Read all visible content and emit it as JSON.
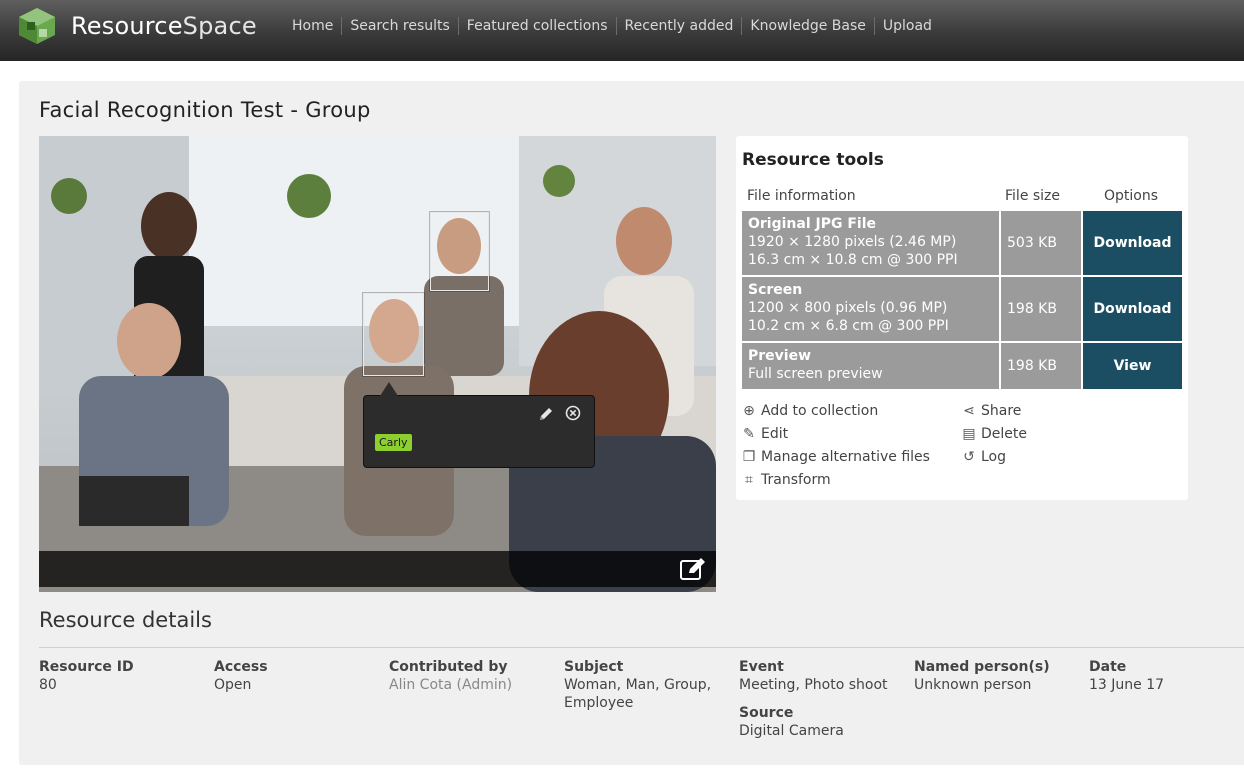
{
  "app": {
    "name_bold": "Resource",
    "name_light": "Space"
  },
  "nav": [
    "Home",
    "Search results",
    "Featured collections",
    "Recently added",
    "Knowledge Base",
    "Upload"
  ],
  "page": {
    "title": "Facial Recognition Test - Group"
  },
  "preview": {
    "tag_label": "Carly"
  },
  "tools": {
    "title": "Resource tools",
    "headers": {
      "info": "File information",
      "size": "File size",
      "options": "Options"
    },
    "files": [
      {
        "name": "Original JPG File",
        "line1": "1920 × 1280 pixels (2.46 MP)",
        "line2": "16.3 cm × 10.8 cm @ 300 PPI",
        "size": "503 KB",
        "action": "Download"
      },
      {
        "name": "Screen",
        "line1": "1200 × 800 pixels (0.96 MP)",
        "line2": "10.2 cm × 6.8 cm @ 300 PPI",
        "size": "198 KB",
        "action": "Download"
      },
      {
        "name": "Preview",
        "line1": "Full screen preview",
        "line2": "",
        "size": "198 KB",
        "action": "View"
      }
    ],
    "actions": {
      "add_to_collection": "Add to collection",
      "share": "Share",
      "edit": "Edit",
      "delete": "Delete",
      "manage_alternative": "Manage alternative files",
      "log": "Log",
      "transform": "Transform"
    }
  },
  "details": {
    "title": "Resource details",
    "fields": {
      "resource_id": {
        "label": "Resource ID",
        "value": "80"
      },
      "access": {
        "label": "Access",
        "value": "Open"
      },
      "contributed_by": {
        "label": "Contributed by",
        "value": "Alin Cota (Admin)"
      },
      "subject": {
        "label": "Subject",
        "value_line1": "Woman, Man, Group,",
        "value_line2": "Employee"
      },
      "event": {
        "label": "Event",
        "value": "Meeting, Photo shoot"
      },
      "named_persons": {
        "label": "Named person(s)",
        "value": "Unknown person"
      },
      "date": {
        "label": "Date",
        "value": "13 June 17"
      },
      "source": {
        "label": "Source",
        "value": "Digital Camera"
      }
    }
  }
}
